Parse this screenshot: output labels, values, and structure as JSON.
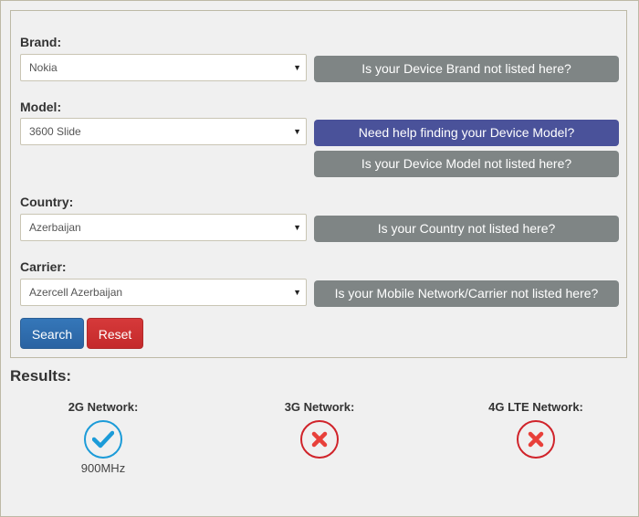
{
  "form": {
    "fields": [
      {
        "label": "Brand:",
        "value": "Nokia"
      },
      {
        "label": "Model:",
        "value": "3600 Slide"
      },
      {
        "label": "Country:",
        "value": "Azerbaijan"
      },
      {
        "label": "Carrier:",
        "value": "Azercell Azerbaijan"
      }
    ],
    "help_buttons": {
      "brand_not_listed": "Is your Device Brand not listed here?",
      "find_model": "Need help finding your Device Model?",
      "model_not_listed": "Is your Device Model not listed here?",
      "country_not_listed": "Is your Country not listed here?",
      "carrier_not_listed": "Is your Mobile Network/Carrier not listed here?"
    },
    "search_label": "Search",
    "reset_label": "Reset",
    "dropdown_icon": "caret-down-icon"
  },
  "results": {
    "title": "Results:",
    "networks": [
      {
        "label": "2G Network:",
        "status": "supported",
        "icon": "check-icon",
        "frequency": "900MHz"
      },
      {
        "label": "3G Network:",
        "status": "not-supported",
        "icon": "x-icon",
        "frequency": ""
      },
      {
        "label": "4G LTE Network:",
        "status": "not-supported",
        "icon": "x-icon",
        "frequency": ""
      }
    ]
  },
  "colors": {
    "gray_button": "#7f8585",
    "purple_button": "#4a529a",
    "search_button": "#2f6eb0",
    "reset_button": "#cd3132",
    "check": "#1b9bd8",
    "cross": "#d0232a"
  }
}
